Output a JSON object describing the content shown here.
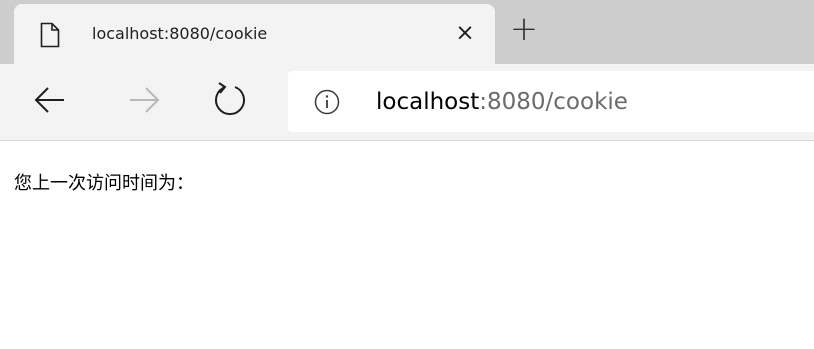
{
  "tab": {
    "title": "localhost:8080/cookie",
    "close_label": "×",
    "new_tab_label": "+"
  },
  "toolbar": {
    "address": {
      "host": "localhost",
      "path": ":8080/cookie"
    }
  },
  "page": {
    "text": "您上一次访问时间为："
  },
  "icons": {
    "tab": "page-icon",
    "back": "arrow-left-icon",
    "forward": "arrow-right-icon",
    "refresh": "refresh-icon",
    "site_info": "info-icon"
  },
  "colors": {
    "tabstrip": "#cdcdcd",
    "toolbar": "#f3f3f3",
    "url_path": "#6b6b6b",
    "forward_disabled": "#b8b8b8"
  }
}
